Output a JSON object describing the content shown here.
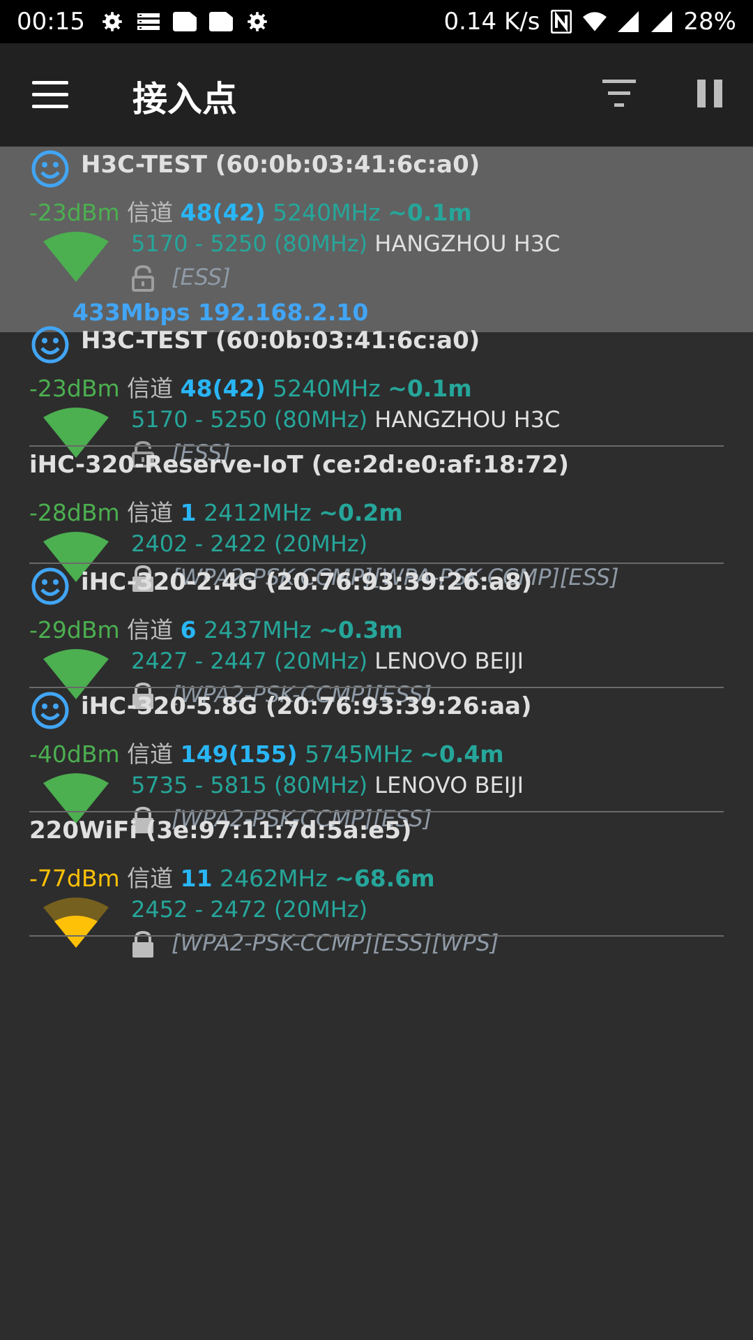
{
  "status_bar": {
    "time": "00:15",
    "net_speed": "0.14 K/s",
    "battery": "28%",
    "icons": [
      "settings-icon",
      "list-icon",
      "sim-icon",
      "sim-icon",
      "settings-icon",
      "nfc-icon",
      "wifi-icon",
      "signal-icon",
      "signal-icon"
    ]
  },
  "app_bar": {
    "title": "接入点",
    "menu_icon": "menu-icon",
    "filter_icon": "filter-icon",
    "pause_icon": "pause-icon"
  },
  "channel_label": "信道",
  "access_points": [
    {
      "ssid": "H3C-TEST (60:0b:03:41:6c:a0)",
      "smiley": true,
      "connected": true,
      "rssi": "-23dBm",
      "channel": "48(42)",
      "freq": "5240MHz",
      "distance": "~0.1m",
      "range": "5170 - 5250 (80MHz)",
      "vendor": "HANGZHOU H3C",
      "security": "[ESS]",
      "locked": false,
      "link": "433Mbps 192.168.2.10",
      "signal_color": "#4caf50",
      "signal_level": 1.0
    },
    {
      "ssid": "H3C-TEST (60:0b:03:41:6c:a0)",
      "smiley": true,
      "connected": false,
      "rssi": "-23dBm",
      "channel": "48(42)",
      "freq": "5240MHz",
      "distance": "~0.1m",
      "range": "5170 - 5250 (80MHz)",
      "vendor": "HANGZHOU H3C",
      "security": "[ESS]",
      "locked": false,
      "signal_color": "#4caf50",
      "signal_level": 1.0
    },
    {
      "ssid": "iHC-320-Reserve-IoT (ce:2d:e0:af:18:72)",
      "smiley": false,
      "connected": false,
      "rssi": "-28dBm",
      "channel": "1",
      "freq": "2412MHz",
      "distance": "~0.2m",
      "range": "2402 - 2422 (20MHz)",
      "vendor": "",
      "security": "[WPA2-PSK-CCMP][WPA-PSK-CCMP][ESS]",
      "locked": true,
      "signal_color": "#4caf50",
      "signal_level": 1.0
    },
    {
      "ssid": "iHC-320-2.4G (20:76:93:39:26:a8)",
      "smiley": true,
      "connected": false,
      "rssi": "-29dBm",
      "channel": "6",
      "freq": "2437MHz",
      "distance": "~0.3m",
      "range": "2427 - 2447 (20MHz)",
      "vendor": "LENOVO BEIJI",
      "security": "[WPA2-PSK-CCMP][ESS]",
      "locked": true,
      "signal_color": "#4caf50",
      "signal_level": 1.0
    },
    {
      "ssid": "iHC-320-5.8G (20:76:93:39:26:aa)",
      "smiley": true,
      "connected": false,
      "rssi": "-40dBm",
      "channel": "149(155)",
      "freq": "5745MHz",
      "distance": "~0.4m",
      "range": "5735 - 5815 (80MHz)",
      "vendor": "LENOVO BEIJI",
      "security": "[WPA2-PSK-CCMP][ESS]",
      "locked": true,
      "signal_color": "#4caf50",
      "signal_level": 1.0
    },
    {
      "ssid": "220WiFi (3e:97:11:7d:5a:e5)",
      "smiley": false,
      "connected": false,
      "rssi": "-77dBm",
      "channel": "11",
      "freq": "2462MHz",
      "distance": "~68.6m",
      "range": "2452 - 2472 (20MHz)",
      "vendor": "",
      "security": "[WPA2-PSK-CCMP][ESS][WPS]",
      "locked": true,
      "signal_color": "#ffc107",
      "signal_level": 0.5
    }
  ]
}
